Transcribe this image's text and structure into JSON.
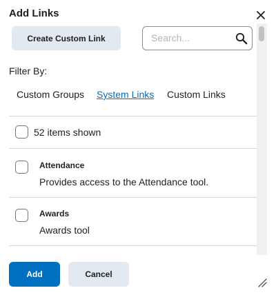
{
  "dialog": {
    "title": "Add Links",
    "close_icon": "close-icon"
  },
  "toolbar": {
    "create_label": "Create Custom Link",
    "search_placeholder": "Search...",
    "search_value": "",
    "search_icon": "search-icon"
  },
  "filter": {
    "label": "Filter By:",
    "tabs": [
      {
        "label": "Custom Groups",
        "active": false
      },
      {
        "label": "System Links",
        "active": true
      },
      {
        "label": "Custom Links",
        "active": false
      }
    ]
  },
  "list": {
    "count_label": "52 items shown",
    "items": [
      {
        "title": "Attendance",
        "description": "Provides access to the Attendance tool.",
        "checked": false
      },
      {
        "title": "Awards",
        "description": "Awards tool",
        "checked": false
      }
    ]
  },
  "footer": {
    "add_label": "Add",
    "cancel_label": "Cancel"
  },
  "colors": {
    "primary": "#006fbf",
    "secondary_button": "#e3e9f1",
    "divider": "#d3d9e3",
    "text": "#202122"
  }
}
